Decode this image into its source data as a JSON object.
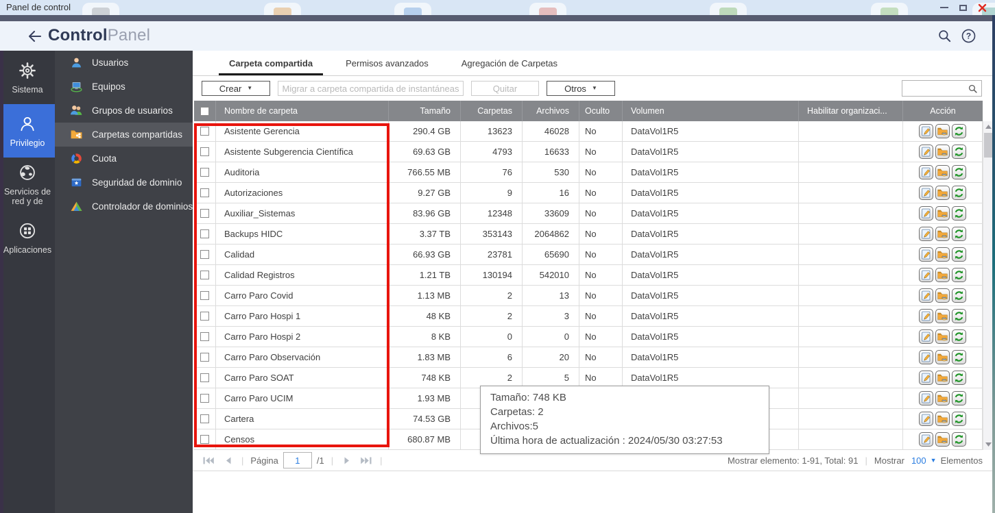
{
  "window": {
    "title": "Panel de control"
  },
  "header": {
    "title_primary": "Control",
    "title_secondary": "Panel"
  },
  "nav": {
    "sections": [
      {
        "label": "Sistema",
        "icon": "gear-icon",
        "active": false
      },
      {
        "label": "Privilegio",
        "icon": "user-outline-icon",
        "active": true
      },
      {
        "label": "Servicios de red y de",
        "icon": "globe-icon",
        "active": false
      },
      {
        "label": "Aplicaciones",
        "icon": "apps-grid-icon",
        "active": false
      }
    ],
    "items": [
      {
        "label": "Usuarios",
        "icon": "user-icon",
        "active": false
      },
      {
        "label": "Equipos",
        "icon": "computer-icon",
        "active": false
      },
      {
        "label": "Grupos de usuarios",
        "icon": "user-group-icon",
        "active": false
      },
      {
        "label": "Carpetas compartidas",
        "icon": "shared-folder-icon",
        "active": true
      },
      {
        "label": "Cuota",
        "icon": "quota-pie-icon",
        "active": false
      },
      {
        "label": "Seguridad de dominio",
        "icon": "domain-security-icon",
        "active": false
      },
      {
        "label": "Controlador de dominios",
        "icon": "domain-controller-icon",
        "active": false
      }
    ]
  },
  "tabs": [
    {
      "label": "Carpeta compartida",
      "active": true
    },
    {
      "label": "Permisos avanzados",
      "active": false
    },
    {
      "label": "Agregación de Carpetas",
      "active": false
    }
  ],
  "toolbar": {
    "create_label": "Crear",
    "migrate_label": "Migrar a carpeta compartida de instantáneas",
    "remove_label": "Quitar",
    "others_label": "Otros",
    "search_value": ""
  },
  "table": {
    "headers": {
      "name": "Nombre de carpeta",
      "size": "Tamaño",
      "folders": "Carpetas",
      "files": "Archivos",
      "hidden": "Oculto",
      "volume": "Volumen",
      "organize": "Habilitar organizaci...",
      "action": "Acción"
    },
    "action_icons": [
      "edit-icon",
      "folder-permissions-icon",
      "refresh-icon"
    ],
    "rows": [
      {
        "name": "Asistente Gerencia",
        "size": "290.4 GB",
        "folders": "13623",
        "files": "46028",
        "hidden": "No",
        "volume": "DataVol1R5"
      },
      {
        "name": "Asistente Subgerencia Científica",
        "size": "69.63 GB",
        "folders": "4793",
        "files": "16633",
        "hidden": "No",
        "volume": "DataVol1R5"
      },
      {
        "name": "Auditoria",
        "size": "766.55 MB",
        "folders": "76",
        "files": "530",
        "hidden": "No",
        "volume": "DataVol1R5"
      },
      {
        "name": "Autorizaciones",
        "size": "9.27 GB",
        "folders": "9",
        "files": "16",
        "hidden": "No",
        "volume": "DataVol1R5"
      },
      {
        "name": "Auxiliar_Sistemas",
        "size": "83.96 GB",
        "folders": "12348",
        "files": "33609",
        "hidden": "No",
        "volume": "DataVol1R5"
      },
      {
        "name": "Backups HIDC",
        "size": "3.37 TB",
        "folders": "353143",
        "files": "2064862",
        "hidden": "No",
        "volume": "DataVol1R5"
      },
      {
        "name": "Calidad",
        "size": "66.93 GB",
        "folders": "23781",
        "files": "65690",
        "hidden": "No",
        "volume": "DataVol1R5"
      },
      {
        "name": "Calidad Registros",
        "size": "1.21 TB",
        "folders": "130194",
        "files": "542010",
        "hidden": "No",
        "volume": "DataVol1R5"
      },
      {
        "name": "Carro Paro Covid",
        "size": "1.13 MB",
        "folders": "2",
        "files": "13",
        "hidden": "No",
        "volume": "DataVol1R5"
      },
      {
        "name": "Carro Paro Hospi 1",
        "size": "48 KB",
        "folders": "2",
        "files": "3",
        "hidden": "No",
        "volume": "DataVol1R5"
      },
      {
        "name": "Carro Paro Hospi 2",
        "size": "8 KB",
        "folders": "0",
        "files": "0",
        "hidden": "No",
        "volume": "DataVol1R5"
      },
      {
        "name": "Carro Paro Observación",
        "size": "1.83 MB",
        "folders": "6",
        "files": "20",
        "hidden": "No",
        "volume": "DataVol1R5"
      },
      {
        "name": "Carro Paro SOAT",
        "size": "748 KB",
        "folders": "2",
        "files": "5",
        "hidden": "No",
        "volume": "DataVol1R5"
      },
      {
        "name": "Carro Paro UCIM",
        "size": "1.93 MB",
        "folders": "",
        "files": "",
        "hidden": "",
        "volume": ""
      },
      {
        "name": "Cartera",
        "size": "74.53 GB",
        "folders": "",
        "files": "",
        "hidden": "",
        "volume": ""
      },
      {
        "name": "Censos",
        "size": "680.87 MB",
        "folders": "",
        "files": "",
        "hidden": "",
        "volume": ""
      }
    ]
  },
  "tooltip": {
    "line1": "Tamaño: 748 KB",
    "line2": "Carpetas: 2",
    "line3": "Archivos:5",
    "line4": "Última hora de actualización : 2024/05/30 03:27:53"
  },
  "pagination": {
    "page_label": "Página",
    "page_value": "1",
    "page_total": "/1",
    "info": "Mostrar elemento: 1-91, Total: 91",
    "show_label": "Mostrar",
    "page_size": "100",
    "items_label": "Elementos"
  },
  "colors": {
    "accent_blue": "#3b6fd9",
    "link_blue": "#2a7de1",
    "highlight_red": "#e8150d",
    "table_header_gray": "#85878b",
    "sidebar_dark": "#36383f",
    "sidebar_mid": "#3f4147"
  }
}
